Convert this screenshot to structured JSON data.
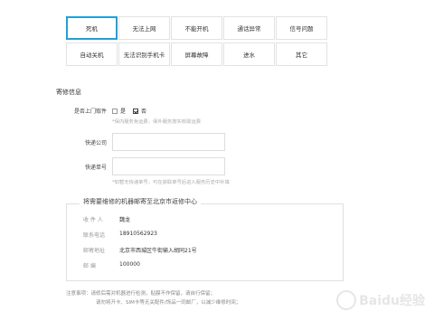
{
  "issues": [
    {
      "label": "死机",
      "selected": true
    },
    {
      "label": "无法上网",
      "selected": false
    },
    {
      "label": "不能开机",
      "selected": false
    },
    {
      "label": "通话异常",
      "selected": false
    },
    {
      "label": "信号问题",
      "selected": false
    },
    {
      "label": "自动关机",
      "selected": false
    },
    {
      "label": "无法识别手机卡",
      "selected": false
    },
    {
      "label": "屏幕故障",
      "selected": false
    },
    {
      "label": "进水",
      "selected": false
    },
    {
      "label": "其它",
      "selected": false
    }
  ],
  "repair": {
    "section_title": "寄修信息",
    "doorstep_label": "是否上门取件",
    "option_yes": "是",
    "option_no": "否",
    "selected_option": "否",
    "doorstep_hint": "*保内服务免运费，保外服务按实收取运费",
    "courier_label": "快递公司",
    "courier_value": "",
    "tracking_label": "快递单号",
    "tracking_value": "",
    "tracking_hint": "*如暂无快递单号，可在获取单号后进入服务历史中补填"
  },
  "address": {
    "title": "将需要维修的机器邮寄至北京市返修中心",
    "rows": [
      {
        "key": "收 件 人",
        "value": "魏龙"
      },
      {
        "key": "联系电话",
        "value": "18910562923"
      },
      {
        "key": "邮寄地址",
        "value": "北京市西城区牛街输入胡同21号"
      },
      {
        "key": "邮    编",
        "value": "100000"
      }
    ]
  },
  "notes": {
    "line1": "注意事项：请修后需对机器进行检测，贴膜不作保留，请自行保留；",
    "line2": "请勿将开卡、SIM卡等无关配件/饰品一同邮厂，以减少维修时间；"
  },
  "watermark": "Baidu经验"
}
